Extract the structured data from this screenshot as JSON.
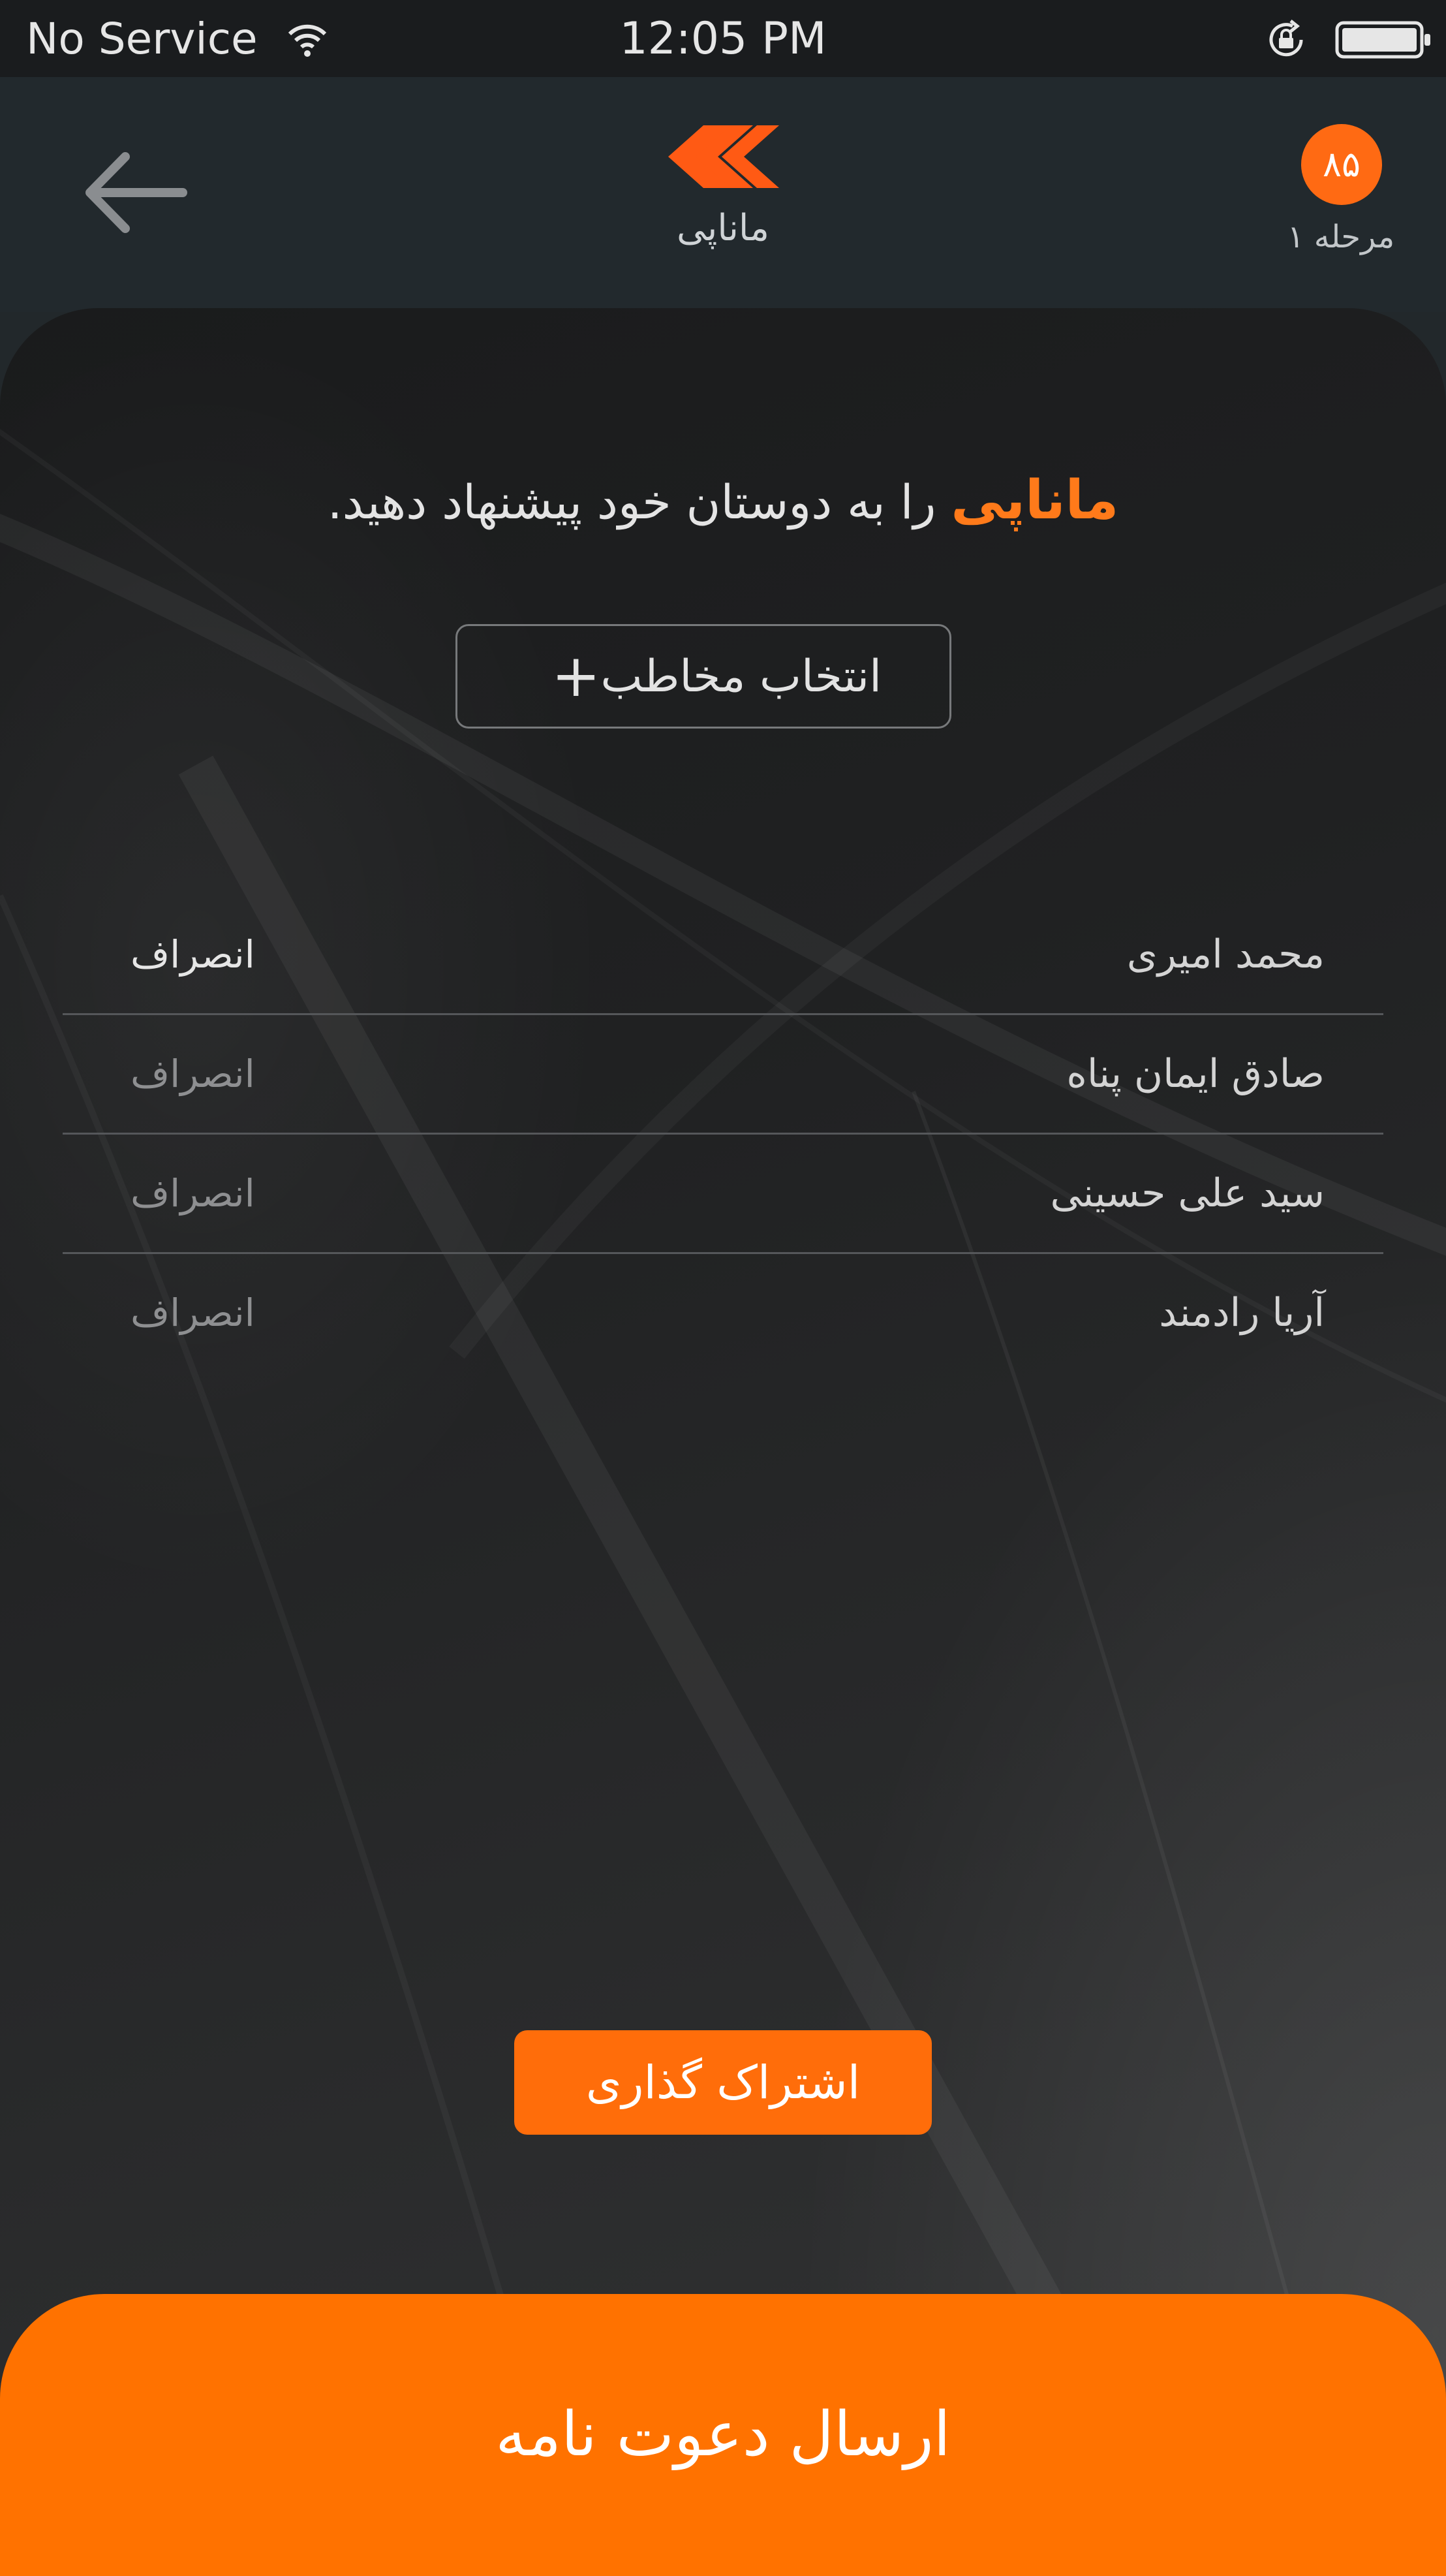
{
  "status_bar": {
    "carrier": "No Service",
    "time": "12:05 PM",
    "icons": [
      "wifi-icon",
      "rotation-lock-icon",
      "battery-icon"
    ]
  },
  "header": {
    "back_icon": "arrow-left-icon",
    "logo_icon": "chevrons-logo-icon",
    "logo_text": "ماناپی",
    "score": "۸۵",
    "stage": "مرحله ۱"
  },
  "invite": {
    "brand": "ماناپی",
    "text": "را به دوستان خود پیشنهاد دهید."
  },
  "select_contact": {
    "label": "انتخاب مخاطب",
    "icon": "plus-icon"
  },
  "contacts": [
    {
      "name": "محمد امیری",
      "cancel": "انصراف"
    },
    {
      "name": "صادق ایمان پناه",
      "cancel": "انصراف"
    },
    {
      "name": "سید علی حسینی",
      "cancel": "انصراف"
    },
    {
      "name": "آریا رادمند",
      "cancel": "انصراف"
    }
  ],
  "share_button": "اشتراک گذاری",
  "send_invite_button": "ارسال دعوت نامه",
  "colors": {
    "accent": "#ff6d0a",
    "background": "#22282b",
    "text": "#e4e4e4"
  }
}
